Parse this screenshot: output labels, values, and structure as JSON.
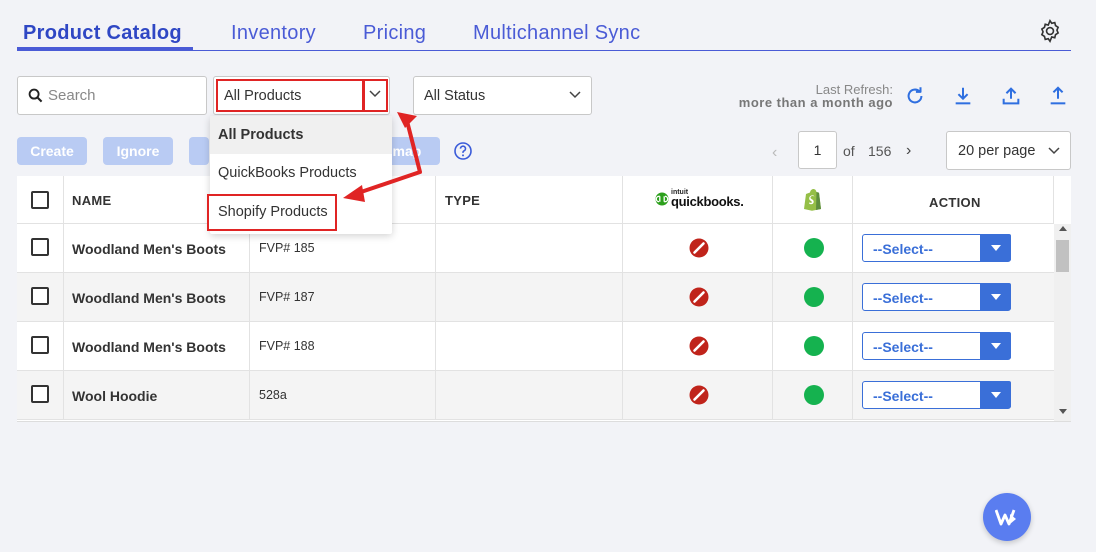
{
  "tabs": [
    {
      "label": "Product Catalog",
      "active": true
    },
    {
      "label": "Inventory"
    },
    {
      "label": "Pricing"
    },
    {
      "label": "Multichannel Sync"
    }
  ],
  "filters": {
    "search_placeholder": "Search",
    "product_filter": "All Products",
    "status_filter": "All Status"
  },
  "refresh": {
    "label": "Last Refresh:",
    "value": "more than a month ago"
  },
  "actions": {
    "create": "Create",
    "ignore": "Ignore",
    "hidden_button": "nmap"
  },
  "pagination": {
    "page": "1",
    "of": "of",
    "total": "156",
    "per_page": "20 per page"
  },
  "dropdown_menu": {
    "items": [
      "All Products",
      "QuickBooks Products",
      "Shopify Products"
    ],
    "selected": "All Products",
    "highlighted": "Shopify Products"
  },
  "table": {
    "headers": {
      "name": "NAME",
      "type": "TYPE",
      "qb_brand_intuit": "intuit",
      "qb_brand": "quickbooks.",
      "action": "ACTION"
    },
    "rows": [
      {
        "name": "Woodland Men's Boots",
        "sku": "FVP# 185",
        "type": "",
        "quickbooks": "not-synced",
        "shopify": "synced",
        "action": "--Select--"
      },
      {
        "name": "Woodland Men's Boots",
        "sku": "FVP# 187",
        "type": "",
        "quickbooks": "not-synced",
        "shopify": "synced",
        "action": "--Select--"
      },
      {
        "name": "Woodland Men's Boots",
        "sku": "FVP# 188",
        "type": "",
        "quickbooks": "not-synced",
        "shopify": "synced",
        "action": "--Select--"
      },
      {
        "name": "Wool Hoodie",
        "sku": "528a",
        "type": "",
        "quickbooks": "not-synced",
        "shopify": "synced",
        "action": "--Select--"
      }
    ]
  },
  "colors": {
    "brand": "#4a5bd6",
    "highlight": "#e02424",
    "synced": "#15b24f",
    "not_synced": "#c0241b",
    "select_accent": "#3a6fd8"
  },
  "icons": [
    "gear-icon",
    "search-icon",
    "chevron-down-icon",
    "refresh-icon",
    "download-icon",
    "upload-icon",
    "export-icon",
    "help-icon",
    "not-synced-icon",
    "synced-dot-icon",
    "shopify-icon",
    "quickbooks-icon"
  ]
}
